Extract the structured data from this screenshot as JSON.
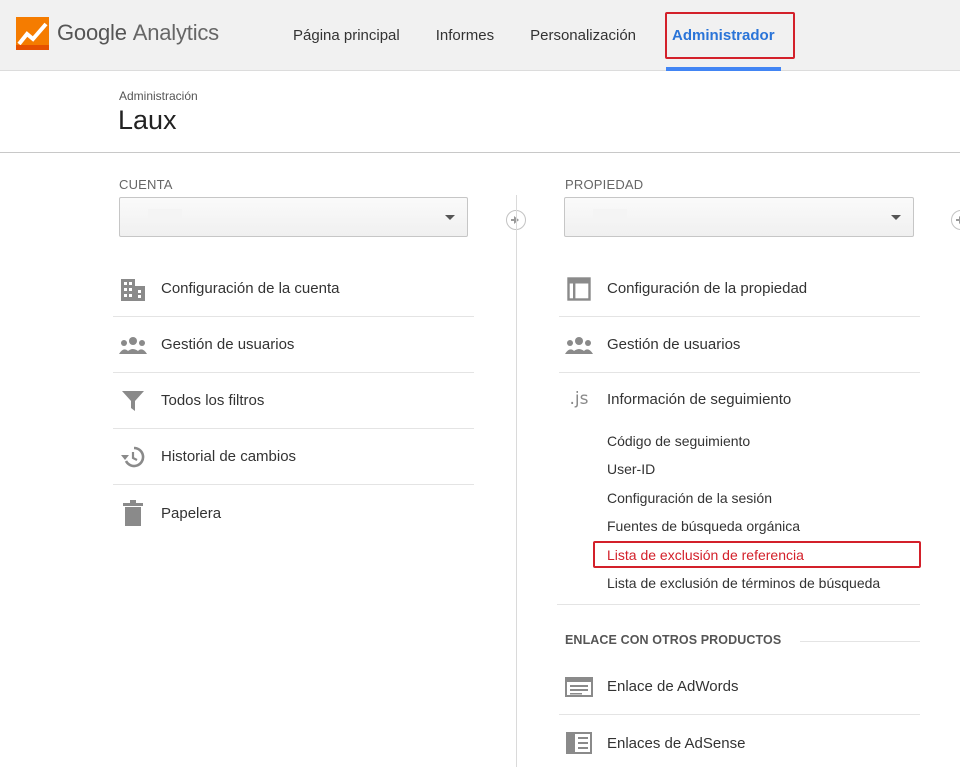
{
  "app": {
    "brand": "Google",
    "product": "Analytics"
  },
  "nav": {
    "items": [
      {
        "label": "Página principal"
      },
      {
        "label": "Informes"
      },
      {
        "label": "Personalización"
      },
      {
        "label": "Administrador",
        "active": true
      }
    ]
  },
  "header": {
    "breadcrumb": "Administración",
    "title": "Laux"
  },
  "account": {
    "column_label": "CUENTA",
    "selected": "",
    "items": [
      {
        "label": "Configuración de la cuenta",
        "icon": "building-icon"
      },
      {
        "label": "Gestión de usuarios",
        "icon": "users-icon"
      },
      {
        "label": "Todos los filtros",
        "icon": "filter-icon"
      },
      {
        "label": "Historial de cambios",
        "icon": "history-icon"
      },
      {
        "label": "Papelera",
        "icon": "trash-icon"
      }
    ]
  },
  "property": {
    "column_label": "PROPIEDAD",
    "selected": "",
    "items": [
      {
        "label": "Configuración de la propiedad",
        "icon": "window-icon"
      },
      {
        "label": "Gestión de usuarios",
        "icon": "users-icon"
      },
      {
        "label": "Información de seguimiento",
        "icon": "js-icon"
      }
    ],
    "js_glyph": ".js",
    "tracking_sub": [
      "Código de seguimiento",
      "User-ID",
      "Configuración de la sesión",
      "Fuentes de búsqueda orgánica",
      "Lista de exclusión de referencia",
      "Lista de exclusión de términos de búsqueda"
    ],
    "section_title": "ENLACE CON OTROS PRODUCTOS",
    "links": [
      {
        "label": "Enlace de AdWords",
        "icon": "adwords-icon"
      },
      {
        "label": "Enlaces de AdSense",
        "icon": "adsense-icon"
      }
    ]
  },
  "colors": {
    "accent": "#4285f4",
    "highlight": "#d3202a",
    "logo_orange": "#f57c00"
  }
}
